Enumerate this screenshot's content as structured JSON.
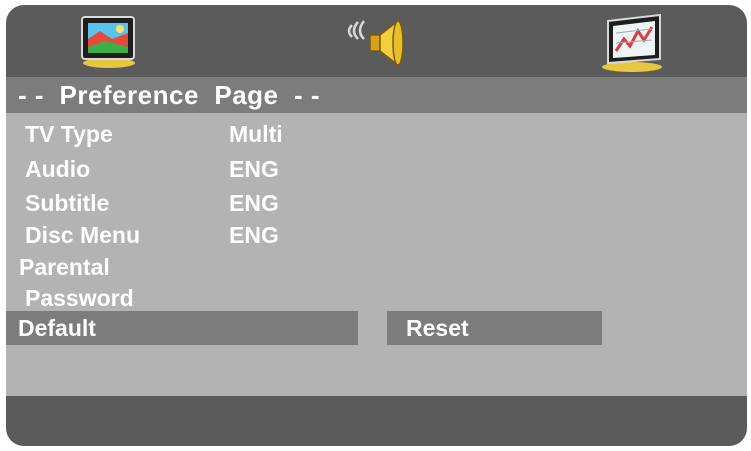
{
  "tabs": [
    {
      "name": "general-setup-tab",
      "icon": "tv-icon"
    },
    {
      "name": "audio-setup-tab",
      "icon": "speaker-icon"
    },
    {
      "name": "preference-tab",
      "icon": "chart-monitor-icon"
    }
  ],
  "page": {
    "title": "- -  Preference  Page  - -"
  },
  "settings": [
    {
      "label": "TV Type",
      "value": "Multi"
    },
    {
      "label": "Audio",
      "value": "ENG"
    },
    {
      "label": "Subtitle",
      "value": "ENG"
    },
    {
      "label": "Disc Menu",
      "value": "ENG"
    },
    {
      "label": "Parental",
      "value": ""
    },
    {
      "label": "Password",
      "value": ""
    }
  ],
  "default_row": {
    "label": "Default",
    "action": "Reset"
  },
  "colors": {
    "panel": "#b3b3b3",
    "bar_dark": "#5b5b5b",
    "bar_mid": "#7c7c7c",
    "text": "#ffffff"
  }
}
